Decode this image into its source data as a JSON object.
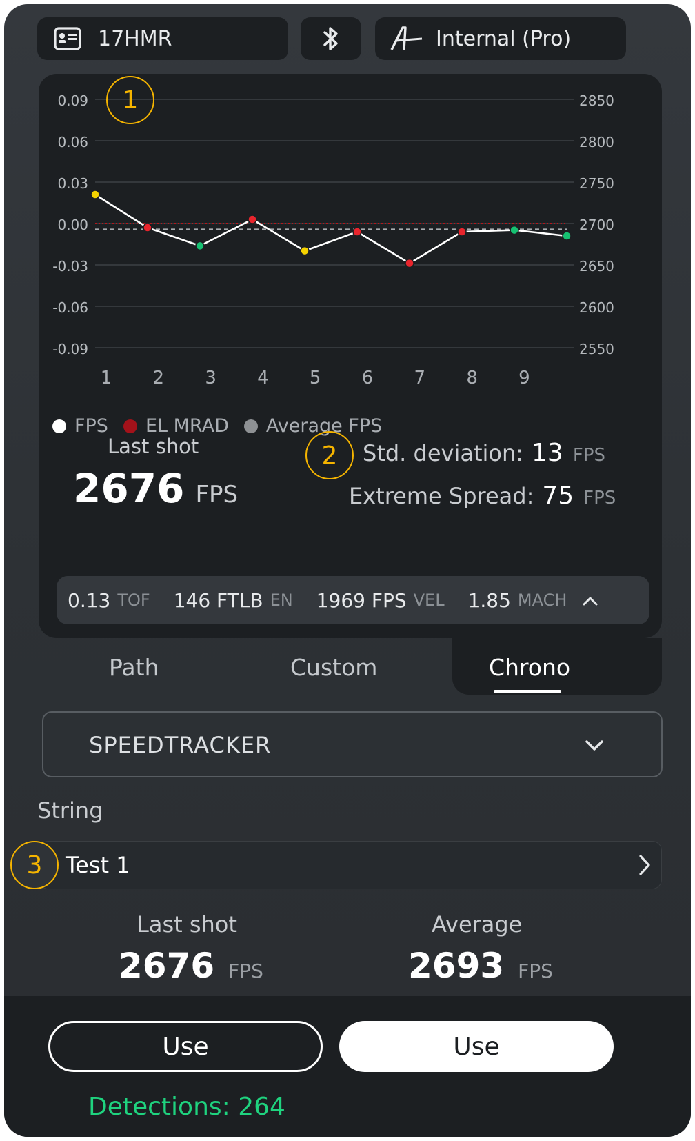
{
  "header": {
    "profile_name": "17HMR",
    "engine_label": "Internal (Pro)"
  },
  "annotations": {
    "m1": "1",
    "m2": "2",
    "m3": "3"
  },
  "chart_data": {
    "type": "line",
    "x": [
      1,
      2,
      3,
      4,
      5,
      6,
      7,
      8,
      9,
      10
    ],
    "x_tick_labels": [
      "1",
      "2",
      "3",
      "4",
      "5",
      "6",
      "7",
      "8",
      "9"
    ],
    "y_left_ticks": [
      "0.09",
      "0.06",
      "0.03",
      "0.00",
      "-0.03",
      "-0.06",
      "-0.09"
    ],
    "y_right_ticks": [
      "2850",
      "2800",
      "2750",
      "2700",
      "2650",
      "2600",
      "2550"
    ],
    "ylim_left": [
      -0.09,
      0.09
    ],
    "ylim_right": [
      2550,
      2850
    ],
    "series": [
      {
        "name": "FPS",
        "axis": "right",
        "values": [
          2735,
          2695,
          2673,
          2705,
          2667,
          2690,
          2652,
          2690,
          2692,
          2685
        ]
      },
      {
        "name": "Average FPS",
        "axis": "right",
        "values": [
          2693,
          2693,
          2693,
          2693,
          2693,
          2693,
          2693,
          2693,
          2693,
          2693
        ]
      },
      {
        "name": "EL MRAD",
        "axis": "left",
        "values": [
          0,
          0,
          0,
          0,
          0,
          0,
          0,
          0,
          0,
          0
        ]
      }
    ],
    "point_status": [
      "yellow",
      "red",
      "green",
      "red",
      "yellow",
      "red",
      "red",
      "red",
      "green",
      "green"
    ],
    "colors": {
      "FPS": "#ffffff",
      "EL MRAD": "#b5161b",
      "Average FPS": "#8e9194",
      "yellow": "#f5d200",
      "red": "#e8252d",
      "green": "#16c172"
    },
    "grid": true,
    "legend": "bottom-left"
  },
  "summary": {
    "last_shot_label": "Last shot",
    "last_shot_value": "2676",
    "fps_unit": "FPS",
    "std_label": "Std. deviation:",
    "std_value": "13",
    "es_label": "Extreme Spread:",
    "es_value": "75"
  },
  "ballistics": {
    "tof_value": "0.13",
    "tof_unit": "TOF",
    "energy_value": "146 FTLB",
    "energy_unit": "EN",
    "vel_value": "1969 FPS",
    "vel_unit": "VEL",
    "mach_value": "1.85",
    "mach_unit": "MACH"
  },
  "tabs": [
    "Path",
    "Custom",
    "Chrono"
  ],
  "active_tab": "Chrono",
  "chrono": {
    "device": "SPEEDTRACKER",
    "string_label": "String",
    "string_value": "Test 1",
    "last_shot_label": "Last shot",
    "last_shot_value": "2676",
    "average_label": "Average",
    "average_value": "2693",
    "unit": "FPS",
    "use_left": "Use",
    "use_right": "Use",
    "detections": "Detections: 264"
  }
}
